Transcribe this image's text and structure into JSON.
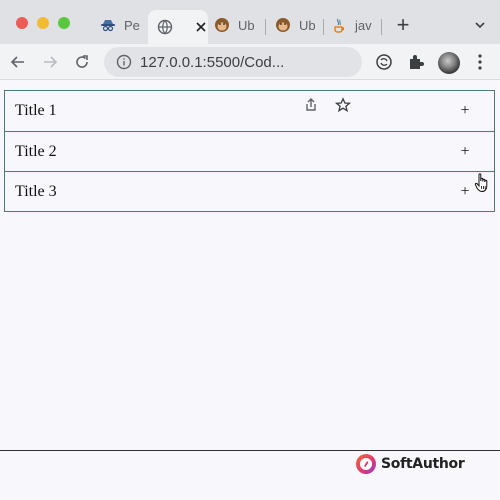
{
  "browser": {
    "tabs": [
      {
        "label": "Pe",
        "icon": "spy-icon",
        "active": false
      },
      {
        "label": "",
        "icon": "globe-icon",
        "active": true
      },
      {
        "label": "Ub",
        "icon": "monkey-icon",
        "active": false
      },
      {
        "label": "Ub",
        "icon": "monkey-icon",
        "active": false
      },
      {
        "label": "jav",
        "icon": "java-icon",
        "active": false
      }
    ],
    "url": "127.0.0.1:5500/Cod..."
  },
  "accordion": {
    "items": [
      {
        "title": "Title 1",
        "toggle": "+"
      },
      {
        "title": "Title 2",
        "toggle": "+"
      },
      {
        "title": "Title 3",
        "toggle": "+"
      }
    ],
    "border_color": "#4f7a77"
  },
  "footer": {
    "brand": "SoftAuthor"
  }
}
